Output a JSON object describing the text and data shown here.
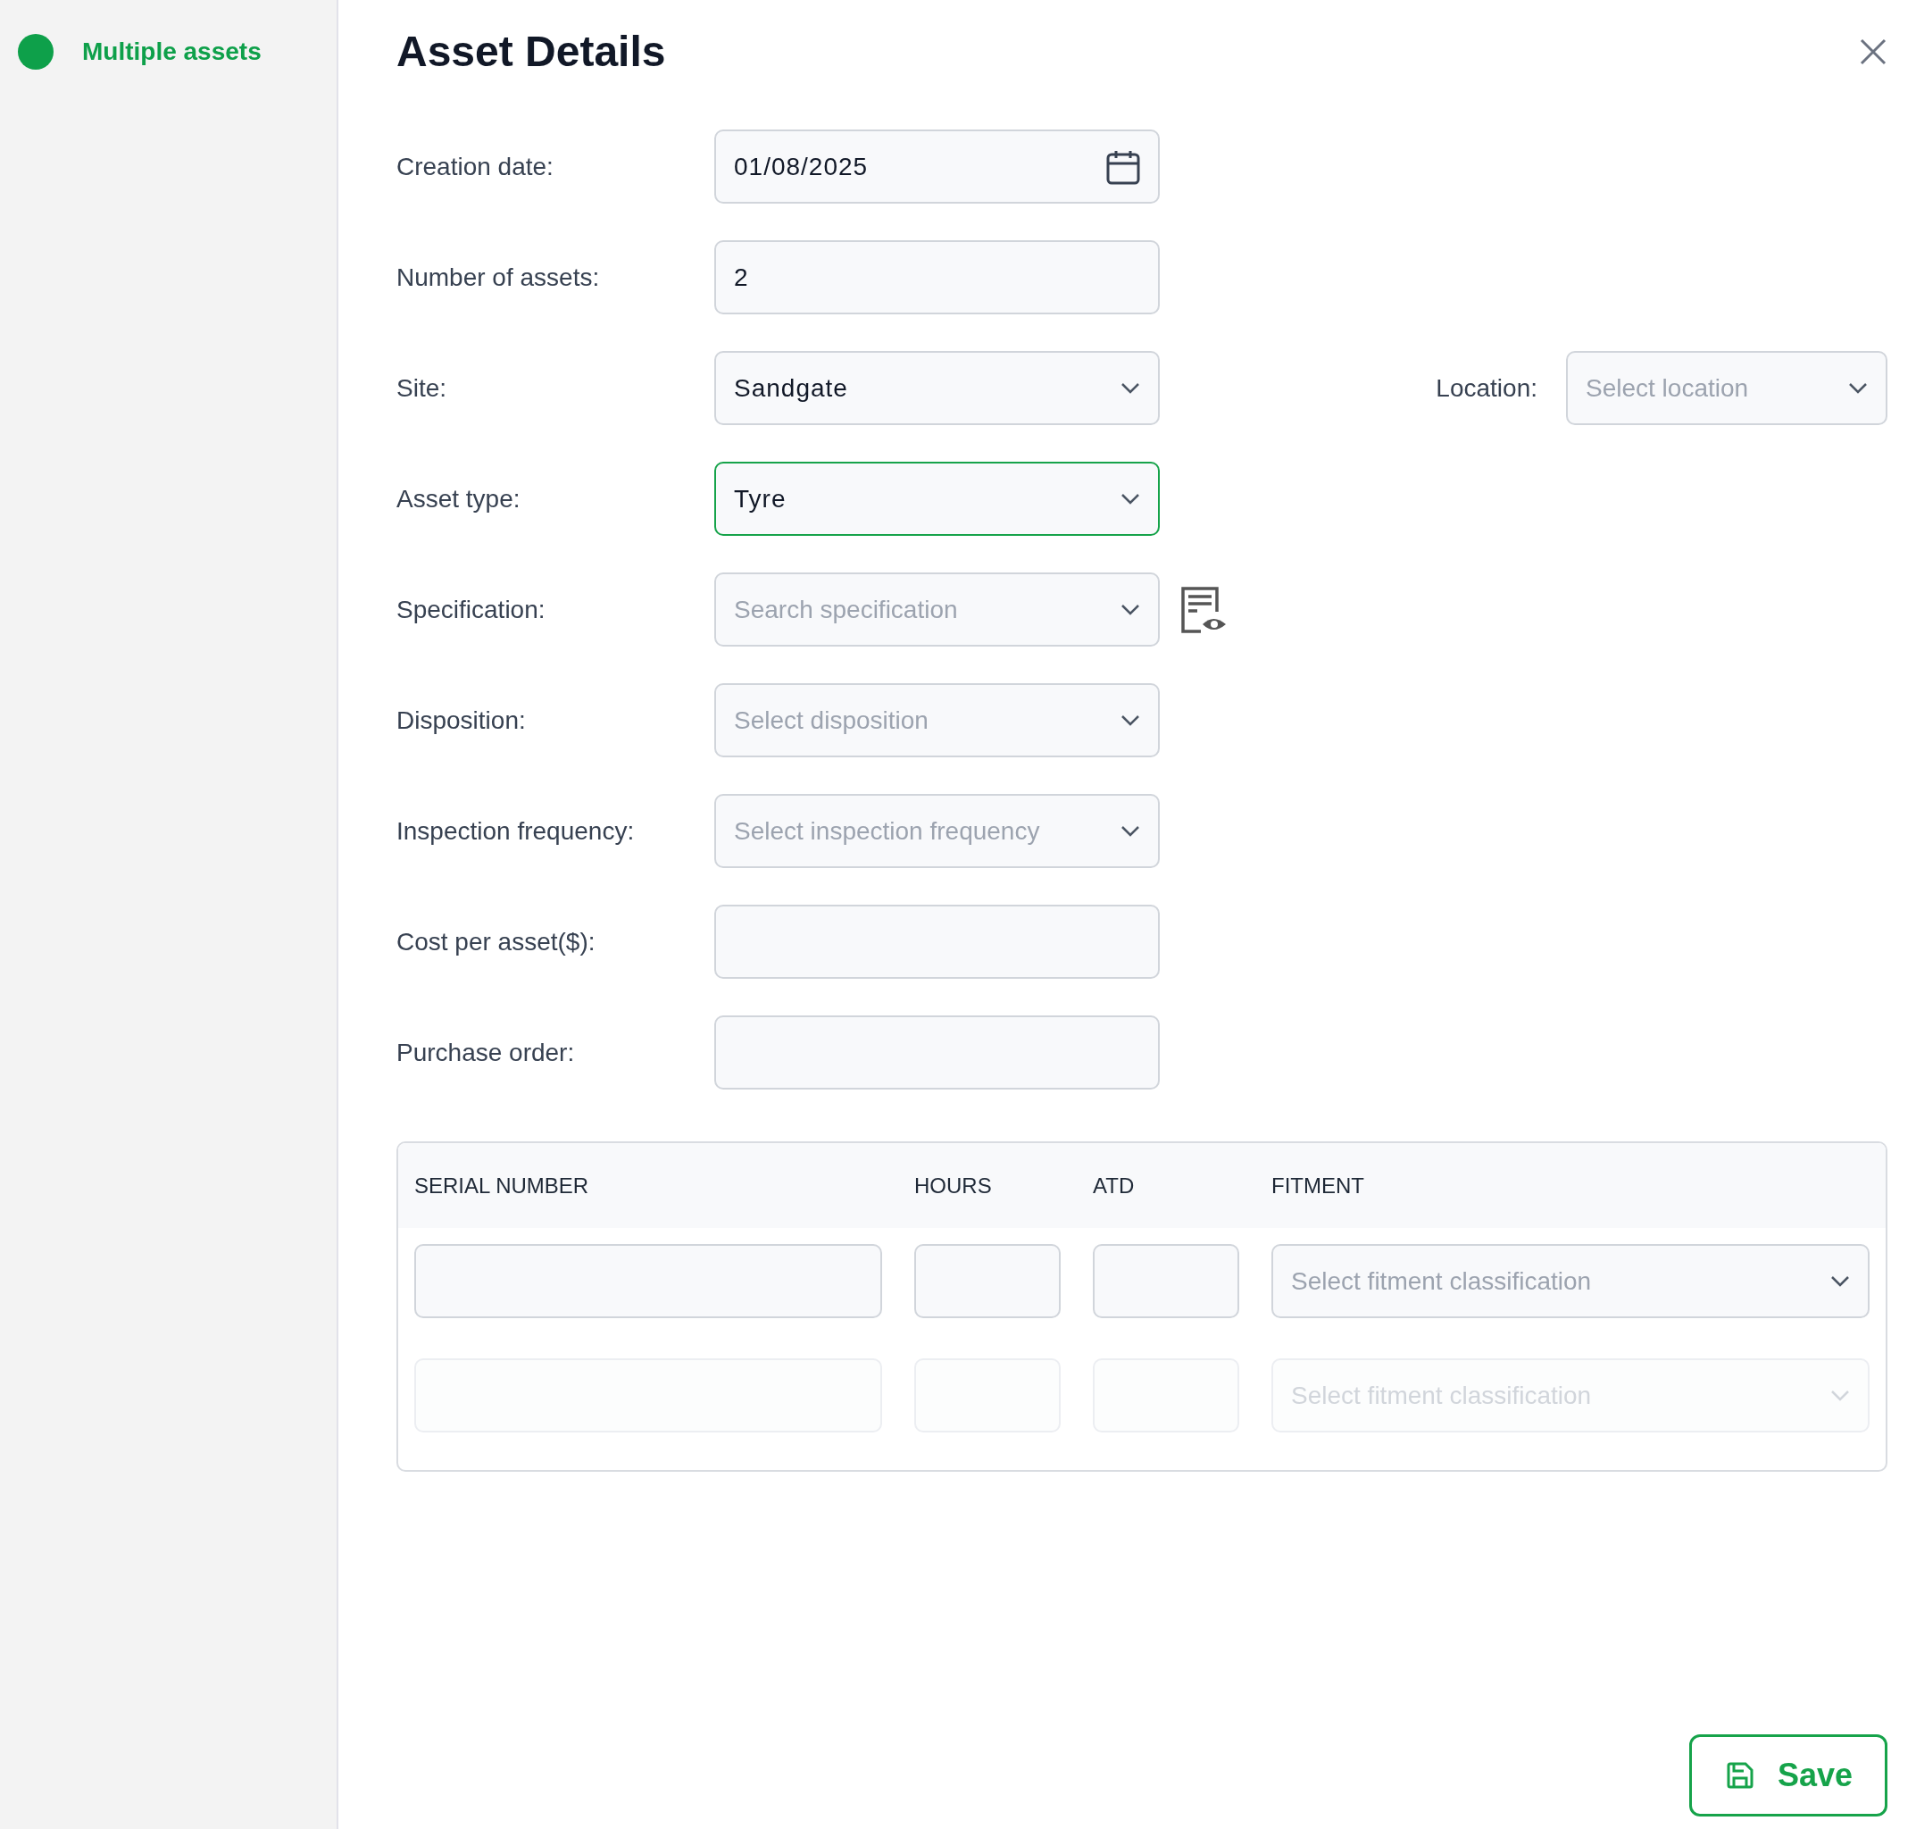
{
  "sidebar": {
    "items": [
      {
        "label": "Multiple assets",
        "color": "#0ea04a",
        "selected": true
      }
    ]
  },
  "title": "Asset Details",
  "fields": [
    {
      "label": "Creation date:",
      "kind": "date",
      "value": "01/08/2025",
      "focused": false
    },
    {
      "label": "Number of assets:",
      "kind": "text",
      "value": "2",
      "focused": false
    },
    {
      "label": "Site:",
      "kind": "select",
      "value": "Sandgate",
      "focused": false,
      "side": {
        "label": "Location:",
        "kind": "select",
        "placeholder": "Select location"
      }
    },
    {
      "label": "Asset type:",
      "kind": "select",
      "value": "Tyre",
      "focused": true
    },
    {
      "label": "Specification:",
      "kind": "select",
      "placeholder": "Search specification",
      "focused": false,
      "preview": true
    },
    {
      "label": "Disposition:",
      "kind": "select",
      "placeholder": "Select disposition",
      "focused": false
    },
    {
      "label": "Inspection frequency:",
      "kind": "select",
      "placeholder": "Select inspection frequency",
      "focused": false
    },
    {
      "label": "Cost per asset($):",
      "kind": "text",
      "focused": false
    },
    {
      "label": "Purchase order:",
      "kind": "text",
      "focused": false
    }
  ],
  "table": {
    "columns": [
      "SERIAL NUMBER",
      "HOURS",
      "ATD",
      "FITMENT"
    ],
    "rows": [
      {
        "disabled": false,
        "fitment_placeholder": "Select fitment classification"
      },
      {
        "disabled": true,
        "fitment_placeholder": "Select fitment classification"
      }
    ]
  },
  "save_button": "Save"
}
